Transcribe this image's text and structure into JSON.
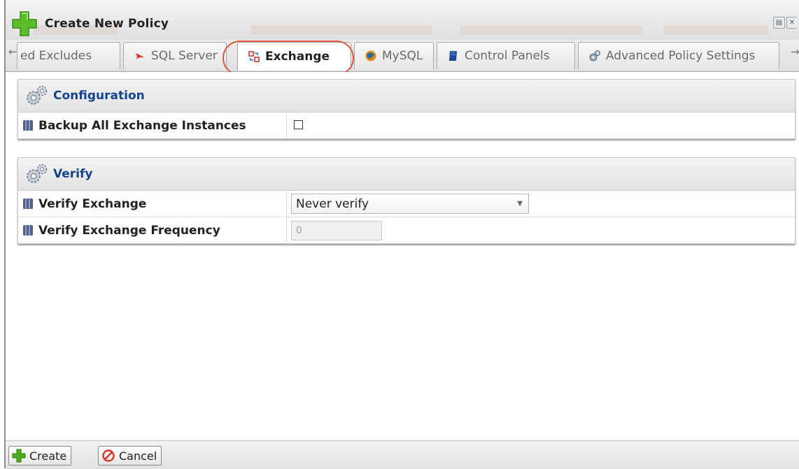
{
  "window": {
    "title": "Create New Policy",
    "controls": [
      "restore-icon",
      "close-icon"
    ]
  },
  "tabs": {
    "scroll_left_icon": "arrow-left-icon",
    "scroll_right_icon": "arrow-right-icon",
    "items": [
      {
        "label": "ed Excludes",
        "icon": "none"
      },
      {
        "label": "SQL Server",
        "icon": "sql-server-icon"
      },
      {
        "label": "Exchange",
        "icon": "exchange-icon",
        "active": true
      },
      {
        "label": "MySQL",
        "icon": "mysql-icon"
      },
      {
        "label": "Control Panels",
        "icon": "control-panels-icon"
      },
      {
        "label": "Advanced Policy Settings",
        "icon": "gear-icon"
      }
    ],
    "highlight_color": "#d9573f"
  },
  "sections": [
    {
      "title": "Configuration",
      "rows": [
        {
          "label": "Backup All Exchange Instances",
          "type": "checkbox",
          "checked": false
        }
      ]
    },
    {
      "title": "Verify",
      "rows": [
        {
          "label": "Verify Exchange",
          "type": "select",
          "value": "Never verify"
        },
        {
          "label": "Verify Exchange Frequency",
          "type": "number",
          "value": "0",
          "disabled": true
        }
      ]
    }
  ],
  "footer": {
    "create_label": "Create",
    "cancel_label": "Cancel"
  },
  "colors": {
    "section_title": "#15448e",
    "create_icon": "#4caf1f",
    "cancel_icon": "#d8342a"
  }
}
